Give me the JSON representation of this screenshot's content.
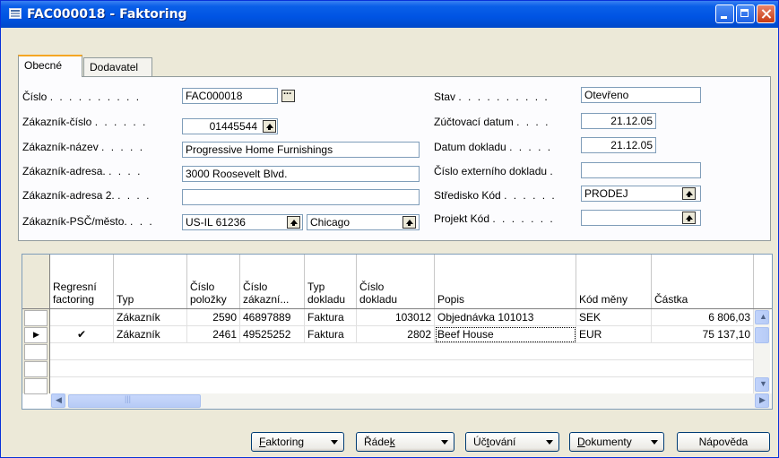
{
  "window": {
    "title": "FAC000018 - Faktoring"
  },
  "tabs": [
    "Obecné",
    "Dodavatel"
  ],
  "form_left": [
    {
      "label": "Číslo",
      "value": "FAC000018"
    },
    {
      "label": "Zákazník-číslo",
      "value": "01445544"
    },
    {
      "label": "Zákazník-název",
      "value": "Progressive Home Furnishings"
    },
    {
      "label": "Zákazník-adresa.",
      "value": "3000 Roosevelt Blvd."
    },
    {
      "label": "Zákazník-adresa 2.",
      "value": ""
    },
    {
      "label": "Zákazník-PSČ/město.",
      "value": "US-IL 61236",
      "value2": "Chicago"
    }
  ],
  "form_right": [
    {
      "label": "Stav",
      "value": "Otevřeno"
    },
    {
      "label": "Zúčtovací datum",
      "value": "21.12.05"
    },
    {
      "label": "Datum dokladu",
      "value": "21.12.05"
    },
    {
      "label": "Číslo externího dokladu",
      "value": ""
    },
    {
      "label": "Středisko Kód",
      "value": "PRODEJ"
    },
    {
      "label": "Projekt Kód",
      "value": ""
    }
  ],
  "grid": {
    "headers": [
      [
        "Regresní",
        "factoring"
      ],
      [
        "Typ"
      ],
      [
        "Číslo",
        "položky"
      ],
      [
        "Číslo",
        "zákazní..."
      ],
      [
        "Typ",
        "dokladu"
      ],
      [
        "Číslo",
        "dokladu"
      ],
      [
        "Popis"
      ],
      [
        "Kód měny"
      ],
      [
        "Částka"
      ]
    ],
    "rows": [
      {
        "regres": "",
        "typ": "Zákazník",
        "polozka": "2590",
        "zakaznik": "46897889",
        "typ_dokladu": "Faktura",
        "doklad": "103012",
        "popis": "Objednávka 101013",
        "mena": "SEK",
        "castka": "6 806,03"
      },
      {
        "regres": "✔",
        "typ": "Zákazník",
        "polozka": "2461",
        "zakaznik": "49525252",
        "typ_dokladu": "Faktura",
        "doklad": "2802",
        "popis": "Beef House",
        "mena": "EUR",
        "castka": "75 137,10"
      }
    ]
  },
  "buttons": {
    "faktoring": {
      "label": "Faktoring",
      "key": "F"
    },
    "radek": {
      "label": "Řádek",
      "key": "k"
    },
    "uctovani": {
      "label": "Účtování",
      "key": "t"
    },
    "dokumenty": {
      "label": "Dokumenty",
      "key": "D"
    },
    "napoveda": {
      "label": "Nápověda"
    }
  }
}
